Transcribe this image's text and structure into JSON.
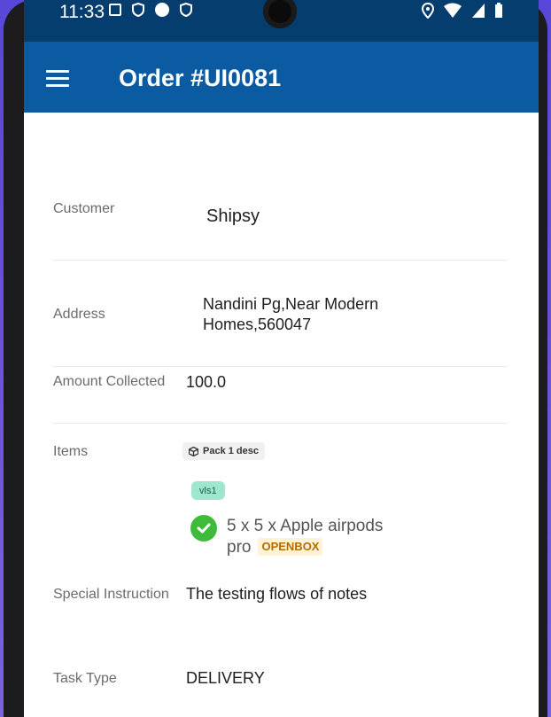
{
  "status_bar": {
    "time": "11:33"
  },
  "app_bar": {
    "title": "Order #UI0081"
  },
  "order": {
    "customer_label": "Customer",
    "customer_value": "Shipsy",
    "address_label": "Address",
    "address_line1": "Nandini Pg,Near Modern",
    "address_line2": "Homes,560047",
    "amount_label": "Amount Collected",
    "amount_value": "100.0",
    "items_label": "Items",
    "pack_chip": "Pack 1 desc",
    "vls_chip": "vls1",
    "item_line1": "5 x 5 x Apple airpods",
    "item_line2": "pro",
    "item_badge": "OPENBOX",
    "instruction_label": "Special Instruction",
    "instruction_value": "The testing flows of notes",
    "task_type_label": "Task Type",
    "task_type_value": "DELIVERY"
  },
  "colors": {
    "status_bar": "#063d6f",
    "app_bar": "#0b5ba2",
    "check": "#3fbb3a",
    "vls_chip": "#9de7cf",
    "openbox_text": "#b56b00"
  },
  "icons": [
    "menu-icon",
    "package-icon",
    "check-circle-icon",
    "wifi-icon",
    "signal-icon",
    "battery-icon",
    "location-icon"
  ]
}
